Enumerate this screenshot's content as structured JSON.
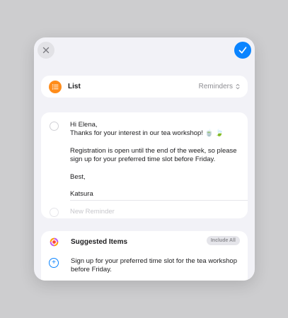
{
  "colors": {
    "accent": "#0a84ff",
    "list_icon": "#ff8c1a",
    "background": "#cdcdcf",
    "sheet": "#f2f2f7"
  },
  "toolbar": {
    "close_icon": "close-icon",
    "confirm_icon": "checkmark-icon"
  },
  "list_row": {
    "icon": "list-icon",
    "label": "List",
    "value": "Reminders",
    "chevron_icon": "up-down-chevron-icon"
  },
  "reminder": {
    "lines": [
      "Hi Elena,",
      "Thanks for your interest in our tea workshop! 🍵 🍃",
      "Registration is open until the end of the week, so please sign up for your preferred time slot before Friday.",
      "Best,",
      "Katsura"
    ],
    "new_placeholder": "New Reminder"
  },
  "suggested": {
    "icon": "suggestions-icon",
    "title": "Suggested Items",
    "include_all": "Include All",
    "items": [
      {
        "icon": "add-icon",
        "text": "Sign up for your preferred time slot for the tea workshop before Friday."
      }
    ]
  }
}
